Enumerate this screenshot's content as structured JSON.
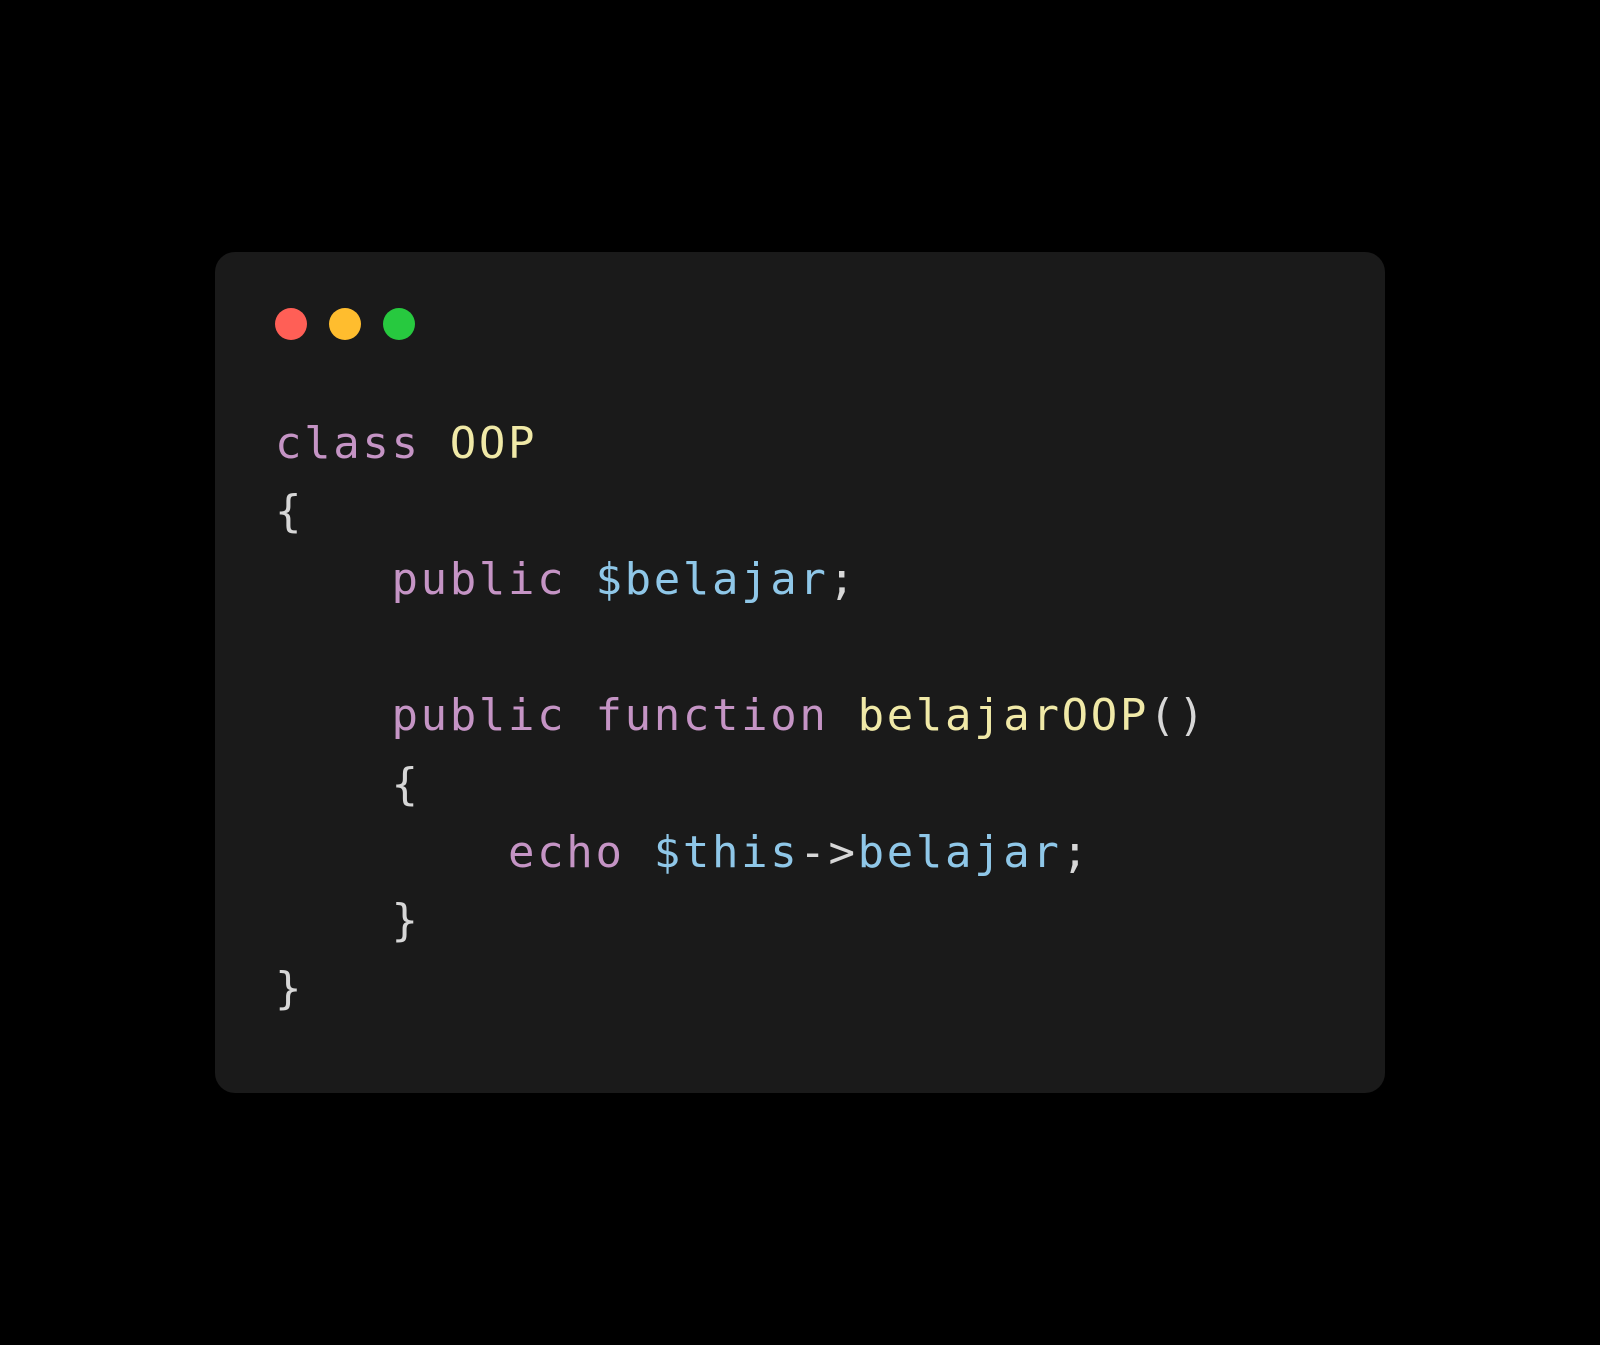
{
  "code": {
    "keywords": {
      "class": "class",
      "public1": "public",
      "public2": "public",
      "function": "function",
      "echo": "echo"
    },
    "identifiers": {
      "className": "OOP",
      "propertyVar": "$belajar",
      "functionName": "belajarOOP",
      "thisVar": "$this",
      "memberAccess": "belajar"
    },
    "punct": {
      "openBrace1": "{",
      "closeBrace1": "}",
      "openBrace2": "{",
      "closeBrace2": "}",
      "semi1": ";",
      "semi2": ";",
      "parens": "()",
      "arrow": "->"
    }
  },
  "colors": {
    "background": "#000000",
    "windowBg": "#1a1a1a",
    "red": "#ff5f56",
    "yellow": "#ffbd2e",
    "green": "#27c93f",
    "keyword": "#c594c5",
    "classname": "#f0e9a7",
    "variable": "#8fc7e8",
    "default": "#d7d7d7"
  }
}
